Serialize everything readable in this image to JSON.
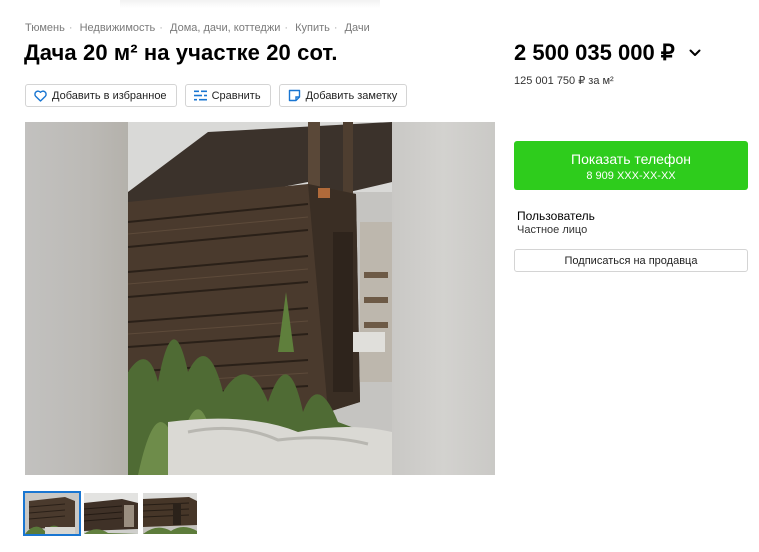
{
  "breadcrumb": [
    "Тюмень",
    "Недвижимость",
    "Дома, дачи, коттеджи",
    "Купить",
    "Дачи"
  ],
  "listing": {
    "title": "Дача 20 м² на участке 20 сот.",
    "price": "2 500 035 000 ₽",
    "price_per_m": "125 001 750 ₽ за м²"
  },
  "actions": {
    "favorite": "Добавить в избранное",
    "compare": "Сравнить",
    "note": "Добавить заметку"
  },
  "contact": {
    "show_phone": "Показать телефон",
    "phone_masked": "8 909 XXX-XX-XX",
    "subscribe": "Подписаться на продавца"
  },
  "seller": {
    "name": "Пользователь",
    "type": "Частное лицо"
  },
  "gallery": {
    "thumbnail_count": 3,
    "selected_index": 0
  },
  "colors": {
    "accent_blue": "#1976d2",
    "button_green": "#2ecc1c",
    "muted_text": "#7a7a7a"
  },
  "icons": {
    "favorite": "heart-icon",
    "compare": "compare-bars-icon",
    "note": "note-icon",
    "price_toggle": "chevron-down-icon"
  }
}
